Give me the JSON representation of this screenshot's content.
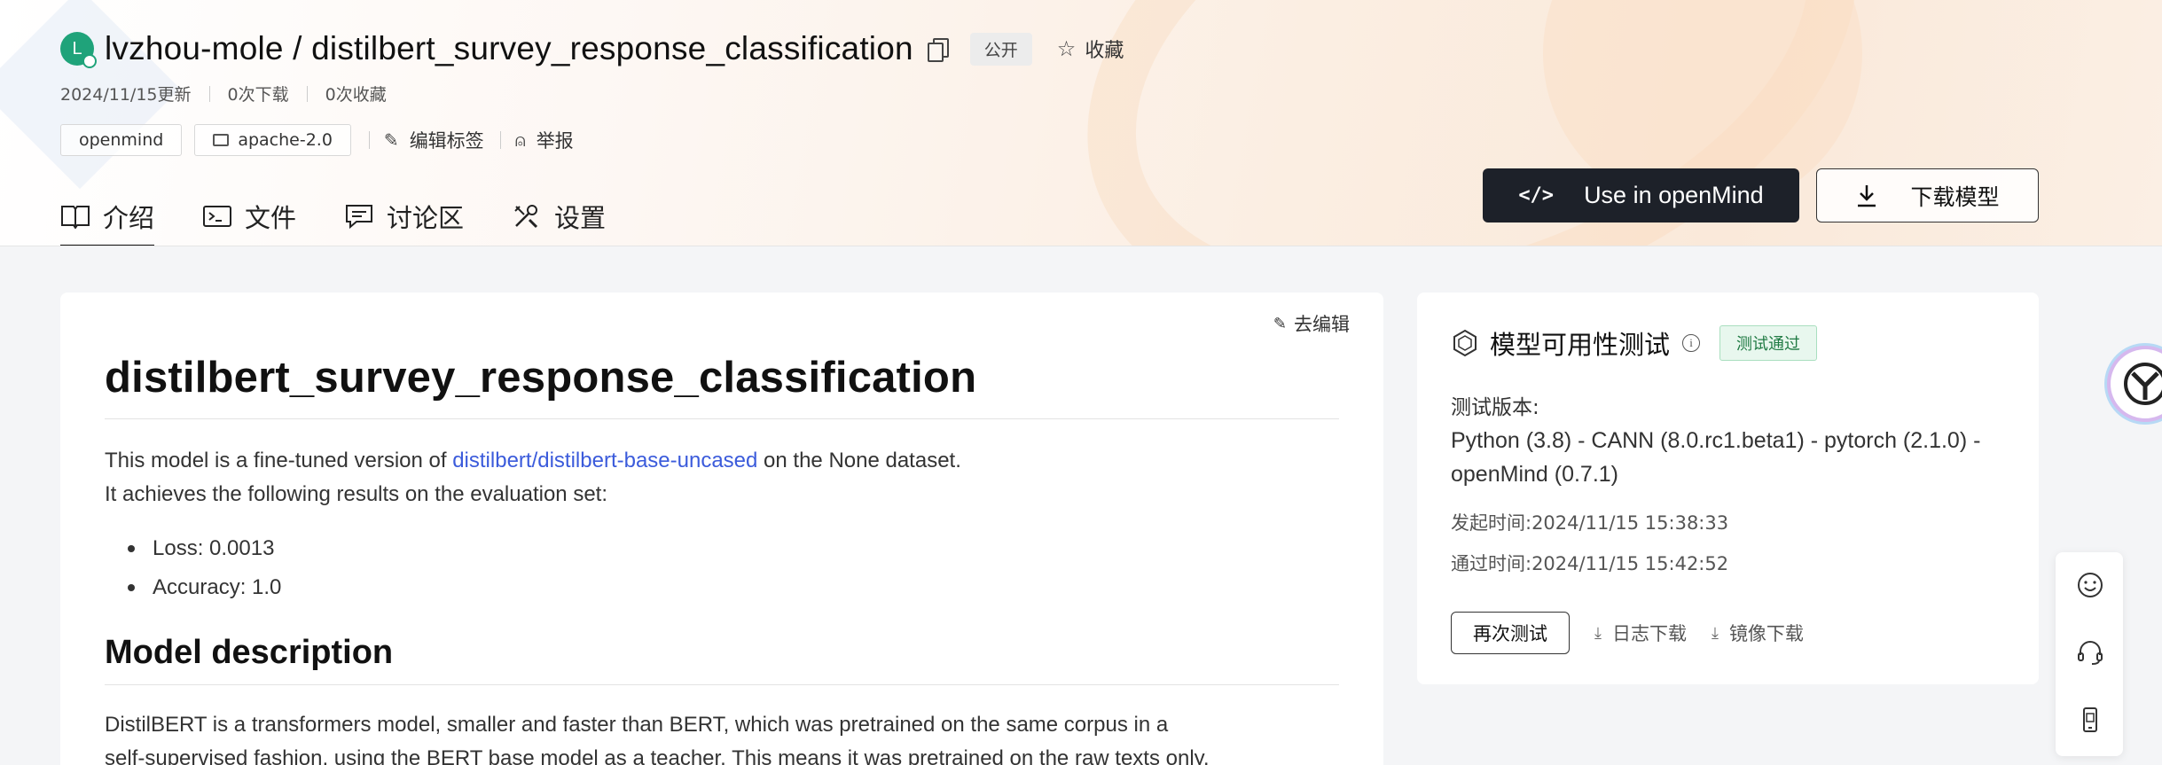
{
  "repo": {
    "avatar_letter": "L",
    "owner": "lvzhou-mole",
    "separator": "/",
    "name": "distilbert_survey_response_classification",
    "visibility": "公开",
    "favorite_label": "收藏"
  },
  "meta": {
    "updated": "2024/11/15更新",
    "downloads": "0次下载",
    "favorites": "0次收藏"
  },
  "tags": {
    "items": [
      "openmind",
      "apache-2.0"
    ],
    "edit_tags": "编辑标签",
    "report": "举报"
  },
  "tabs": [
    {
      "label": "介绍",
      "active": true
    },
    {
      "label": "文件",
      "active": false
    },
    {
      "label": "讨论区",
      "active": false
    },
    {
      "label": "设置",
      "active": false
    }
  ],
  "buttons": {
    "use_in_openmind": "Use in openMind",
    "download_model": "下载模型"
  },
  "readme": {
    "edit": "去编辑",
    "title": "distilbert_survey_response_classification",
    "intro_before": "This model is a fine-tuned version of ",
    "intro_link": "distilbert/distilbert-base-uncased",
    "intro_after": " on the None dataset.",
    "intro_line2": "It achieves the following results on the evaluation set:",
    "results": [
      "Loss: 0.0013",
      "Accuracy: 1.0"
    ],
    "section_title": "Model description",
    "description_line1": "DistilBERT is a transformers model, smaller and faster than BERT, which was pretrained on the same corpus in a",
    "description_line2": "self-supervised fashion, using the BERT base model as a teacher. This means it was pretrained on the raw texts only,"
  },
  "availability": {
    "title": "模型可用性测试",
    "status": "测试通过",
    "version_label": "测试版本:",
    "version_value": "Python (3.8) - CANN (8.0.rc1.beta1) - pytorch (2.1.0) - openMind (0.7.1)",
    "started": "发起时间:2024/11/15 15:38:33",
    "passed": "通过时间:2024/11/15 15:42:52",
    "retest": "再次测试",
    "log_download": "日志下载",
    "image_download": "镜像下载"
  },
  "colors": {
    "accent_dark": "#1d2129",
    "link": "#3b5bdb",
    "avatar": "#1fa37a",
    "pass_bg": "#e8f7ee"
  }
}
